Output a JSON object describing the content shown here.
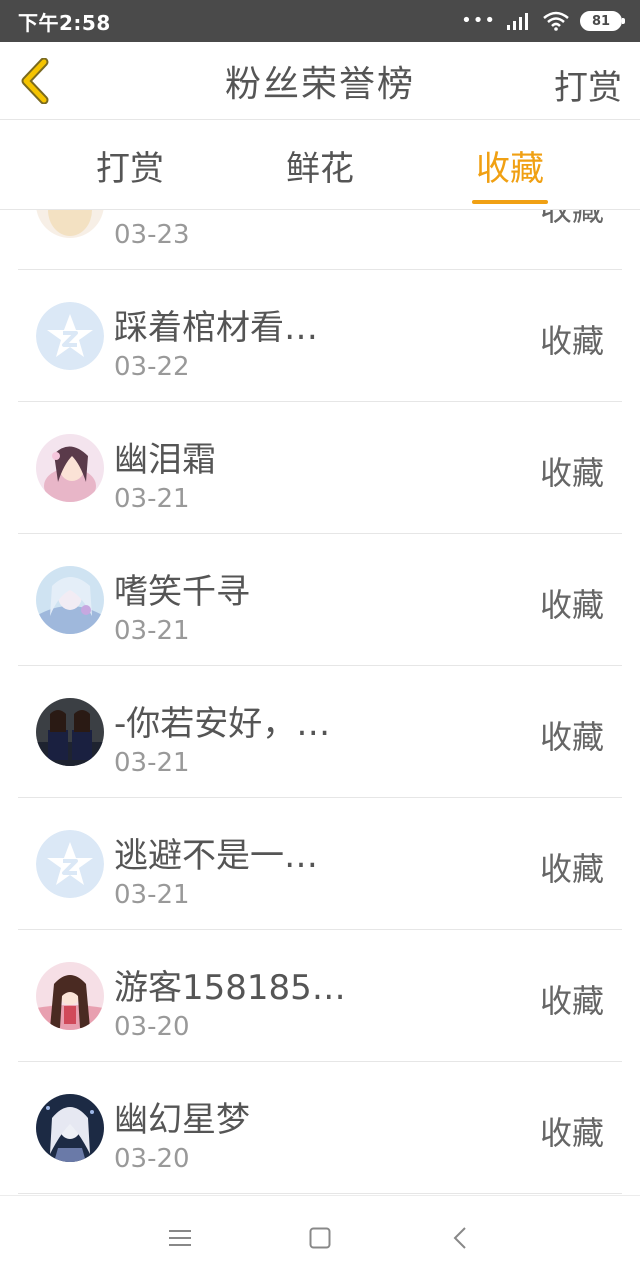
{
  "status_bar": {
    "time": "下午2:58",
    "dots": "•••",
    "battery": "81"
  },
  "header": {
    "title": "粉丝荣誉榜",
    "right_action": "打赏",
    "back_icon": "chevron-left-icon",
    "accent_color": "#f0a013"
  },
  "tabs": [
    {
      "label": "打赏",
      "active": false
    },
    {
      "label": "鲜花",
      "active": false
    },
    {
      "label": "收藏",
      "active": true
    }
  ],
  "list": {
    "items": [
      {
        "name": "",
        "date": "03-23",
        "action": "收藏",
        "avatar": "avatar-illustration-girl"
      },
      {
        "name": "踩着棺材看…",
        "date": "03-22",
        "action": "收藏",
        "avatar": "default-star-avatar"
      },
      {
        "name": "幽泪霜",
        "date": "03-21",
        "action": "收藏",
        "avatar": "avatar-illustration-girl"
      },
      {
        "name": "嗜笑千寻",
        "date": "03-21",
        "action": "收藏",
        "avatar": "avatar-illustration-girl"
      },
      {
        "name": "-你若安好，…",
        "date": "03-21",
        "action": "收藏",
        "avatar": "avatar-photo-group"
      },
      {
        "name": "逃避不是一…",
        "date": "03-21",
        "action": "收藏",
        "avatar": "default-star-avatar"
      },
      {
        "name": "游客158185…",
        "date": "03-20",
        "action": "收藏",
        "avatar": "avatar-illustration-girl"
      },
      {
        "name": "幽幻星梦",
        "date": "03-20",
        "action": "收藏",
        "avatar": "avatar-illustration-girl"
      }
    ]
  },
  "nav_bar": {
    "icons": [
      "menu-icon",
      "home-square-icon",
      "back-arrow-icon"
    ]
  }
}
